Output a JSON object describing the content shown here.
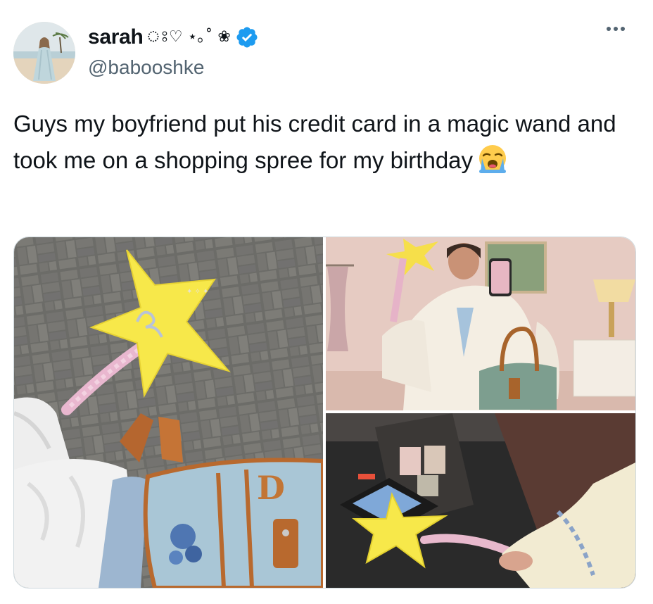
{
  "author": {
    "display_name": "sarah",
    "name_decorations": "ঃ♡ ⋆｡˚ ❀",
    "handle": "@babooshke",
    "verified_icon": "verified-badge-icon",
    "avatar_icon": "profile-avatar"
  },
  "tweet": {
    "text": "Guys my boyfriend put his credit card in a magic wand and took me on a shopping spree for my birthday",
    "emoji_icon": "loudly-crying-face-emoji"
  },
  "menu": {
    "icon": "more-options-icon"
  },
  "media": {
    "photos": [
      {
        "icon": "photo-star-wand-and-handbag"
      },
      {
        "icon": "photo-mirror-selfie-bedroom"
      },
      {
        "icon": "photo-wand-card-reader-checkout"
      }
    ]
  },
  "colors": {
    "verified": "#1d9bf0",
    "secondary_text": "#536471",
    "border": "#cfd9de"
  }
}
